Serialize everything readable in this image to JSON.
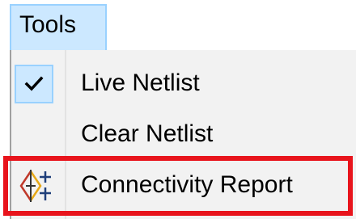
{
  "menubar": {
    "tools_label": "Tools"
  },
  "dropdown": {
    "items": [
      {
        "label": "Live Netlist",
        "checked": true,
        "icon": "check-icon"
      },
      {
        "label": "Clear Netlist",
        "checked": false,
        "icon": ""
      },
      {
        "label": "Connectivity Report",
        "checked": false,
        "icon": "connectivity-report-icon"
      }
    ]
  },
  "colors": {
    "menu_highlight": "#cce8ff",
    "menu_highlight_border": "#99d1ff",
    "menu_background": "#f2f2f2",
    "annotation_box": "#e8141c"
  }
}
